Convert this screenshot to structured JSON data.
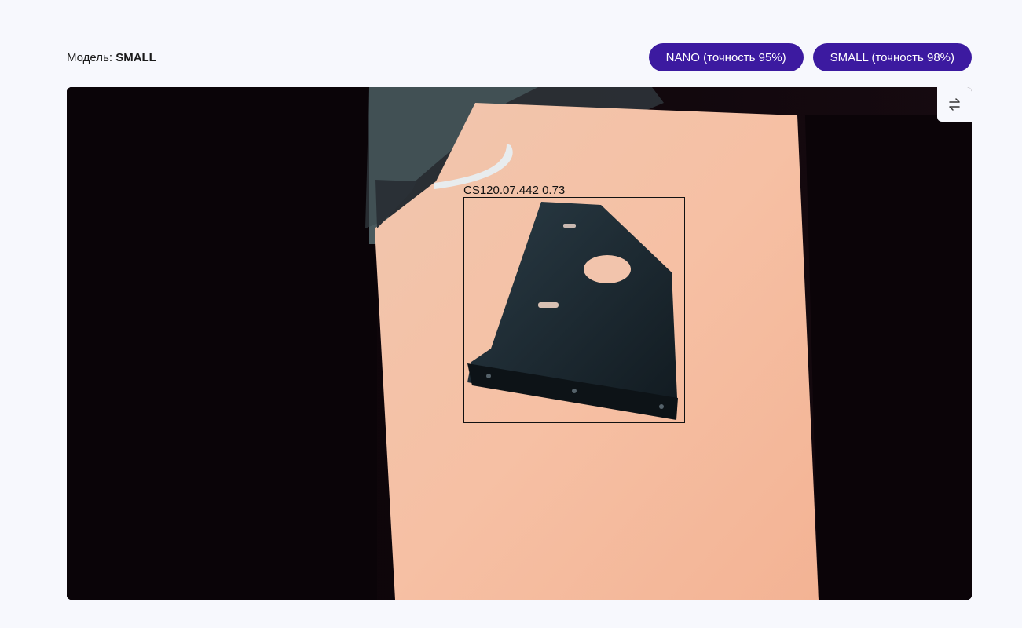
{
  "header": {
    "model_prefix": "Модель:",
    "model_value": "SMALL",
    "buttons": [
      {
        "label": "NANO (точность 95%)"
      },
      {
        "label": "SMALL (точность 98%)"
      }
    ]
  },
  "viewer": {
    "detection_label": "CS120.07.442 0.73",
    "swap_icon": "swap-arrows-icon"
  },
  "colors": {
    "accent": "#3c1aa0",
    "background": "#f7f8fd"
  }
}
